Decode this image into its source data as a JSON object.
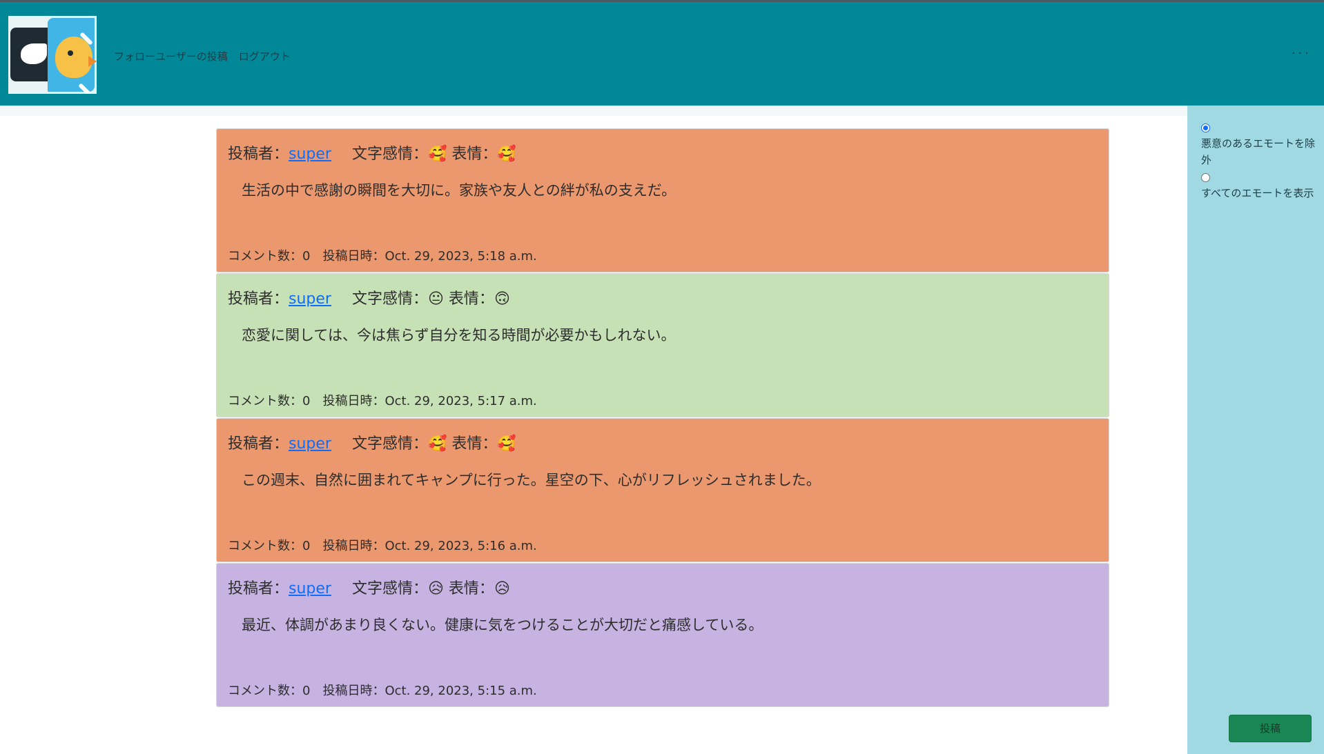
{
  "header": {
    "nav": {
      "followed_posts": "フォローユーザーの投稿",
      "logout": "ログアウト"
    },
    "menu_icon": "more-dots-icon",
    "brand_color": "#008898"
  },
  "posts": [
    {
      "author_label": "投稿者：",
      "author": "super",
      "text_emotion_label": "文字感情：",
      "text_emotion": "🥰",
      "face_emotion_label": "表情：",
      "face_emotion": "🥰",
      "body": "生活の中で感謝の瞬間を大切に。家族や友人との絆が私の支えだ。",
      "comments_label": "コメント数：0",
      "date_label": "投稿日時：Oct. 29, 2023, 5:18 a.m.",
      "bg": "#eb986e"
    },
    {
      "author_label": "投稿者：",
      "author": "super",
      "text_emotion_label": "文字感情：",
      "text_emotion": "😐",
      "face_emotion_label": "表情：",
      "face_emotion": "🙃",
      "body": "恋愛に関しては、今は焦らず自分を知る時間が必要かもしれない。",
      "comments_label": "コメント数：0",
      "date_label": "投稿日時：Oct. 29, 2023, 5:17 a.m.",
      "bg": "#c6e1b5"
    },
    {
      "author_label": "投稿者：",
      "author": "super",
      "text_emotion_label": "文字感情：",
      "text_emotion": "🥰",
      "face_emotion_label": "表情：",
      "face_emotion": "🥰",
      "body": "この週末、自然に囲まれてキャンプに行った。星空の下、心がリフレッシュされました。",
      "comments_label": "コメント数：0",
      "date_label": "投稿日時：Oct. 29, 2023, 5:16 a.m.",
      "bg": "#eb986e"
    },
    {
      "author_label": "投稿者：",
      "author": "super",
      "text_emotion_label": "文字感情：",
      "text_emotion": "😥",
      "face_emotion_label": "表情：",
      "face_emotion": "😥",
      "body": "最近、体調があまり良くない。健康に気をつけることが大切だと痛感している。",
      "comments_label": "コメント数：0",
      "date_label": "投稿日時：Oct. 29, 2023, 5:15 a.m.",
      "bg": "#c6b3e1"
    }
  ],
  "sidebar": {
    "options": [
      {
        "label": "悪意のあるエモートを除外",
        "checked": true
      },
      {
        "label": "すべてのエモートを表示",
        "checked": false
      }
    ],
    "submit_label": "投稿",
    "bg": "#a1d9e3"
  }
}
